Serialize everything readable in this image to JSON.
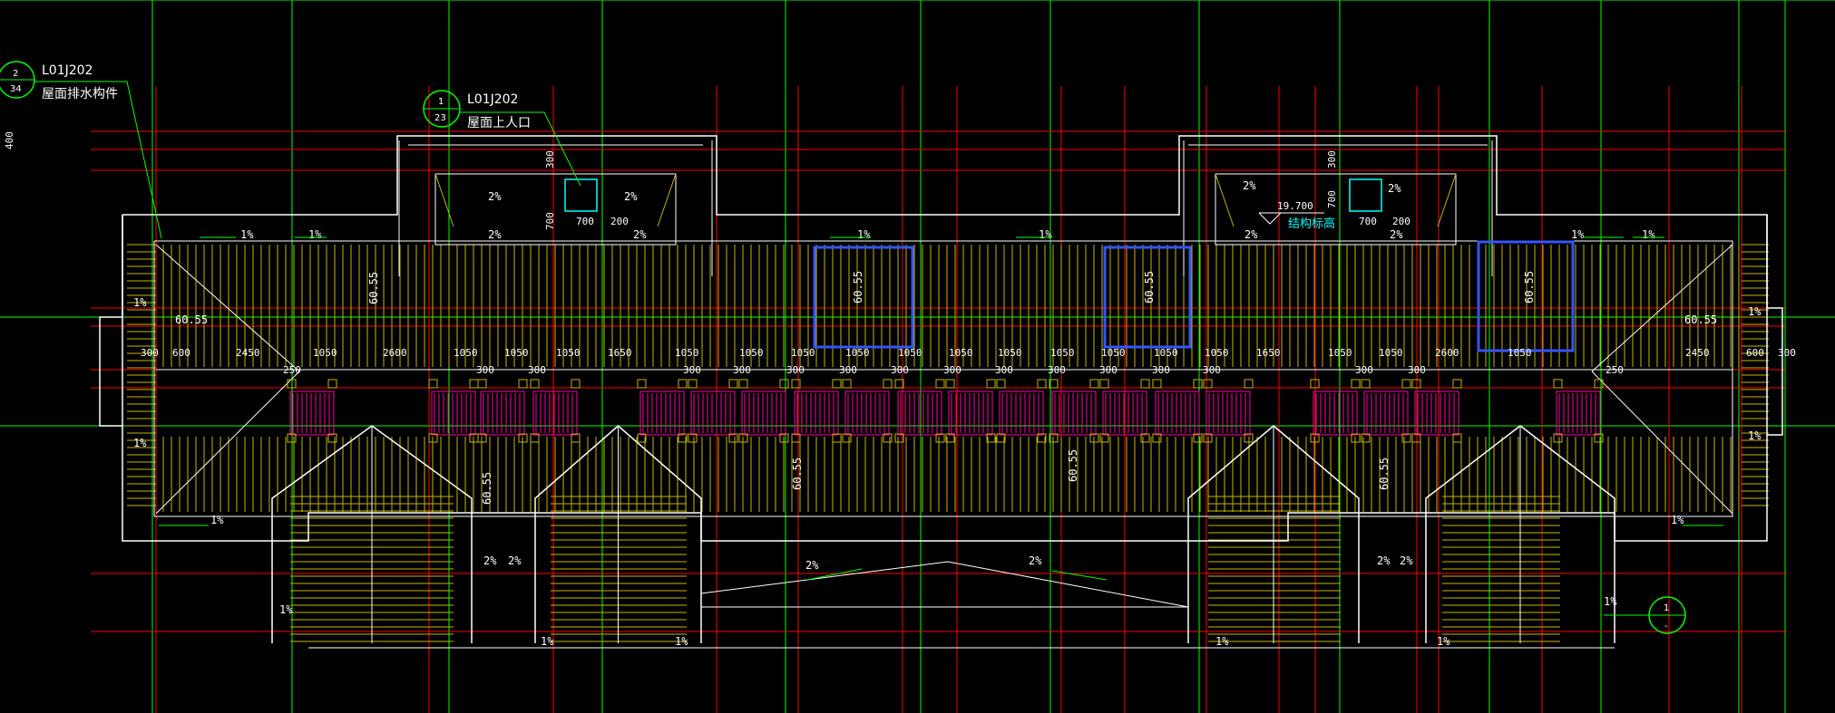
{
  "drawing": {
    "background": "#000000",
    "colors": {
      "axis_red": "#ff0000",
      "grid_green": "#00ff00",
      "outline_white": "#ffffff",
      "hatch_yellow": "#c8b400",
      "vent_magenta": "#ff00aa",
      "opening_blue": "#3355ff",
      "hatch_cyan": "#00ffff"
    }
  },
  "callouts": [
    {
      "number": "2",
      "sheet": "34",
      "code": "L01J202",
      "label": "屋面排水构件"
    },
    {
      "number": "1",
      "sheet": "23",
      "code": "L01J202",
      "label": "屋面上人口"
    },
    {
      "number": "1",
      "sheet": "-",
      "code": "",
      "label": ""
    }
  ],
  "elevation": {
    "value": "19.700",
    "label": "结构标高"
  },
  "left_margin_dim": "400",
  "dims": {
    "top_row": [
      "300",
      "600",
      "2450",
      "1050",
      "2600",
      "1050",
      "1050",
      "1050",
      "1650",
      "1050",
      "1050",
      "1050",
      "1050",
      "1050",
      "1050",
      "1050",
      "1050",
      "1050",
      "1050",
      "1050",
      "1650",
      "1050",
      "1050",
      "2600",
      "1050",
      "2450",
      "600",
      "300"
    ],
    "gaps": [
      "250",
      "300",
      "300",
      "300",
      "300",
      "300",
      "300",
      "300",
      "300",
      "300",
      "300",
      "300",
      "300",
      "300",
      "300",
      "300",
      "250"
    ],
    "hatch_a": {
      "h300": "300",
      "h700": "700",
      "w700": "700",
      "w200": "200"
    }
  },
  "slopes": {
    "gutter": "1%",
    "gable": "2%",
    "pitch": "60.55"
  }
}
